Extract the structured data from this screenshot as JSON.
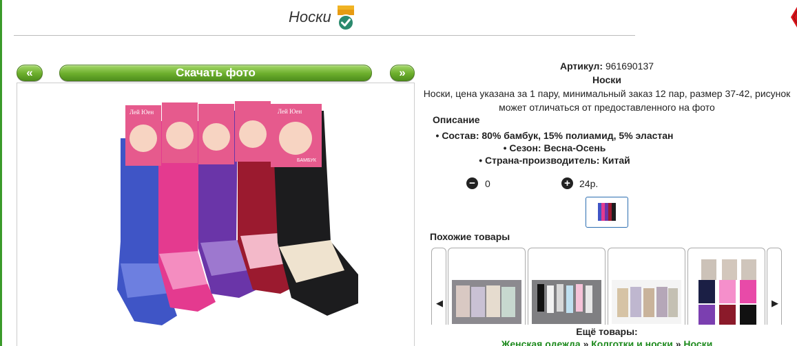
{
  "header": {
    "title": "Носки"
  },
  "photo": {
    "prev_label": "«",
    "next_label": "»",
    "download_label": "Скачать фото"
  },
  "product": {
    "article_label": "Артикул:",
    "article_value": "961690137",
    "name": "Носки",
    "description_line1": "Носки, цена указана за 1 пару, минимальный заказ 12 пар, размер 37-42, рисунок",
    "description_line2": "может отличаться от предоставленного на фото",
    "desc_heading": "Описание",
    "specs": [
      "Состав: 80% бамбук, 15% полиамид, 5% эластан",
      "Сезон: Весна-Осень",
      "Страна-производитель: Китай"
    ],
    "qty": "0",
    "price": "24р."
  },
  "similar": {
    "heading": "Похожие товары",
    "prev_arrow": "◀",
    "next_arrow": "▶"
  },
  "more": {
    "heading": "Ещё товары:",
    "crumbs": [
      "Женская одежда",
      "Колготки и носки",
      "Носки"
    ],
    "separator": "»"
  },
  "colors": {
    "accent_green": "#6cae2c",
    "link_green": "#1d8a1d",
    "selected_border": "#2a6db0"
  },
  "photo_label": {
    "brand": "Лей Юен",
    "sub": "БАМБУК"
  }
}
